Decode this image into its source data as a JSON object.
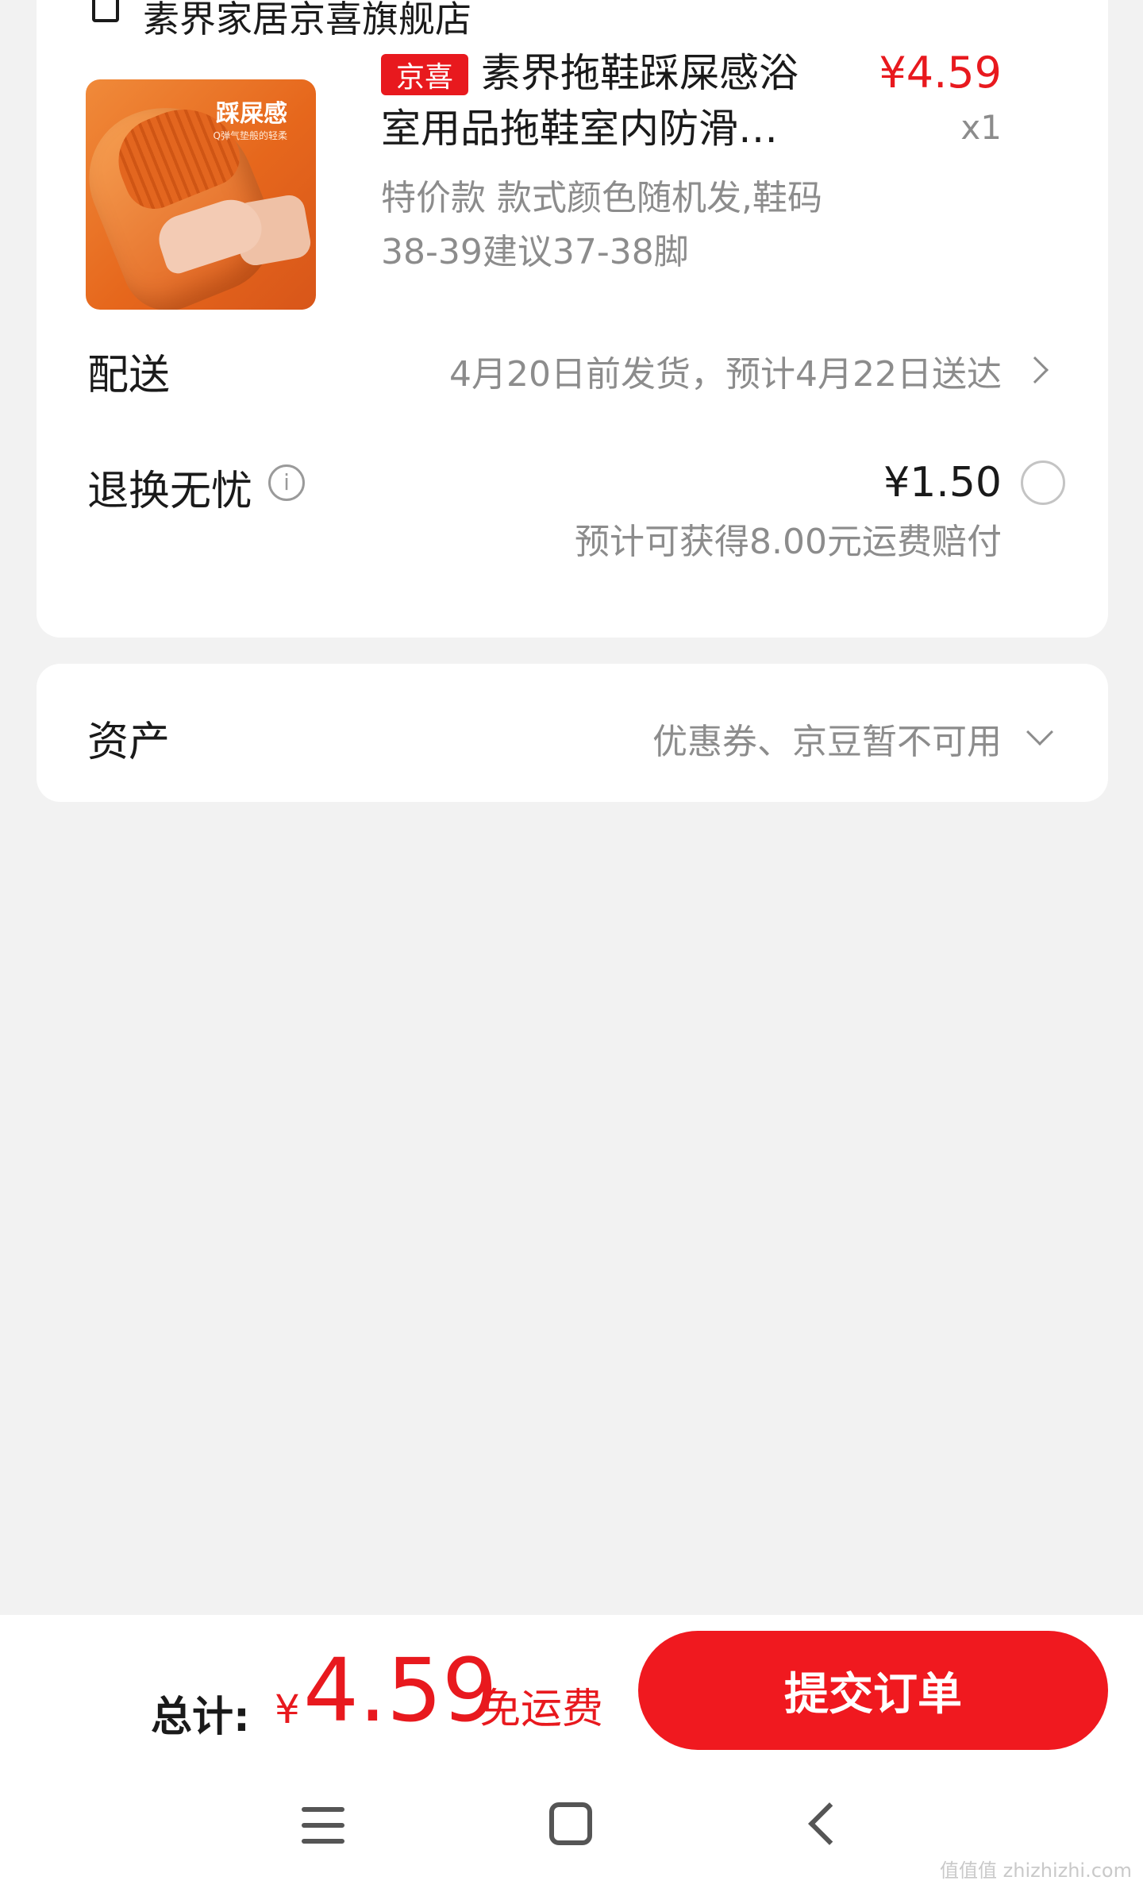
{
  "store": {
    "name": "素界家居京喜旗舰店"
  },
  "product": {
    "image_title": "踩屎感",
    "image_subtitle": "Q弹气垫般的轻柔",
    "tag": "京喜",
    "title_line1": "素界拖鞋踩屎感浴",
    "title_line2": "室用品拖鞋室内防滑…",
    "spec": "特价款  款式颜色随机发,鞋码38-39建议37-38脚",
    "price": "¥4.59",
    "qty": "x1"
  },
  "delivery": {
    "label": "配送",
    "text": "4月20日前发货，预计4月22日送达"
  },
  "return_service": {
    "label": "退换无忧",
    "info_icon": "i",
    "price": "¥1.50",
    "note": "预计可获得8.00元运费赔付"
  },
  "assets": {
    "label": "资产",
    "text": "优惠券、京豆暂不可用"
  },
  "checkout": {
    "total_label": "总计:",
    "currency": "¥",
    "amount": "4.59",
    "shipping": "免运费",
    "submit_label": "提交订单"
  },
  "watermark": "值值值 zhizhizhi.com",
  "colors": {
    "accent": "#e8191e",
    "background": "#f2f2f2",
    "muted_text": "#8c8c8c"
  }
}
